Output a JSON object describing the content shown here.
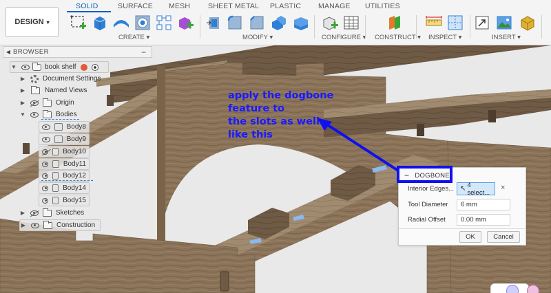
{
  "toolbar": {
    "workspace_label": "DESIGN",
    "tabs": [
      "SOLID",
      "SURFACE",
      "MESH",
      "SHEET METAL",
      "PLASTIC",
      "MANAGE",
      "UTILITIES"
    ],
    "groups": [
      "CREATE",
      "MODIFY",
      "CONFIGURE",
      "CONSTRUCT",
      "INSPECT",
      "INSERT"
    ],
    "accent": "#0b5fbf"
  },
  "browser": {
    "title": "BROWSER",
    "root": "book shelf",
    "items": [
      "Document Settings",
      "Named Views",
      "Origin",
      "Bodies"
    ],
    "bodies": [
      "Body8",
      "Body9",
      "Body10",
      "Body11",
      "Body12",
      "Body14",
      "Body15"
    ],
    "tail": [
      "Sketches",
      "Construction"
    ]
  },
  "annotation": {
    "text": "apply the dogbone\nfeature to\nthe slots as well.\nlike this",
    "color": "#1a1aff"
  },
  "dogbone": {
    "title": "DOGBONE",
    "interior_edges_label": "Interior Edges...",
    "interior_edges_value": "4 select...",
    "tool_diameter_label": "Tool Diameter",
    "tool_diameter_value": "6 mm",
    "radial_offset_label": "Radial Offset",
    "radial_offset_value": "0.00 mm",
    "ok_label": "OK",
    "cancel_label": "Cancel"
  }
}
